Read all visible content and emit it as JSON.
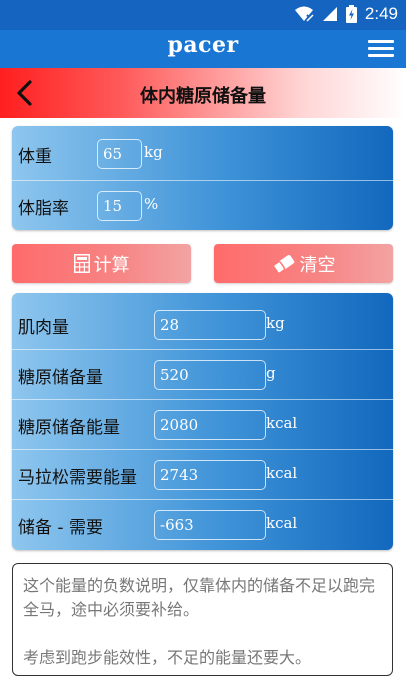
{
  "status_bar": {
    "time": "2:49"
  },
  "app": {
    "title": "pacer"
  },
  "page": {
    "title": "体内糖原储备量"
  },
  "inputs": [
    {
      "label": "体重",
      "value": "65",
      "unit": "kg"
    },
    {
      "label": "体脂率",
      "value": "15",
      "unit": "%"
    }
  ],
  "buttons": {
    "calculate": "计算",
    "clear": "清空"
  },
  "results": [
    {
      "label": "肌肉量",
      "value": "28",
      "unit": "kg"
    },
    {
      "label": "糖原储备量",
      "value": "520",
      "unit": "g"
    },
    {
      "label": "糖原储备能量",
      "value": "2080",
      "unit": "kcal"
    },
    {
      "label": "马拉松需要能量",
      "value": "2743",
      "unit": "kcal"
    },
    {
      "label": "储备 - 需要",
      "value": "-663",
      "unit": "kcal"
    }
  ],
  "note": {
    "line1": "这个能量的负数说明，仅靠体内的储备不足以跑完全马，途中必须要补给。",
    "line2": "考虑到跑步能效性，不足的能量还要大。"
  },
  "colors": {
    "app_bar": "#1976d2",
    "status_bar": "#1565c0",
    "accent_red": "#ff1f1f",
    "button": "#f78585"
  }
}
